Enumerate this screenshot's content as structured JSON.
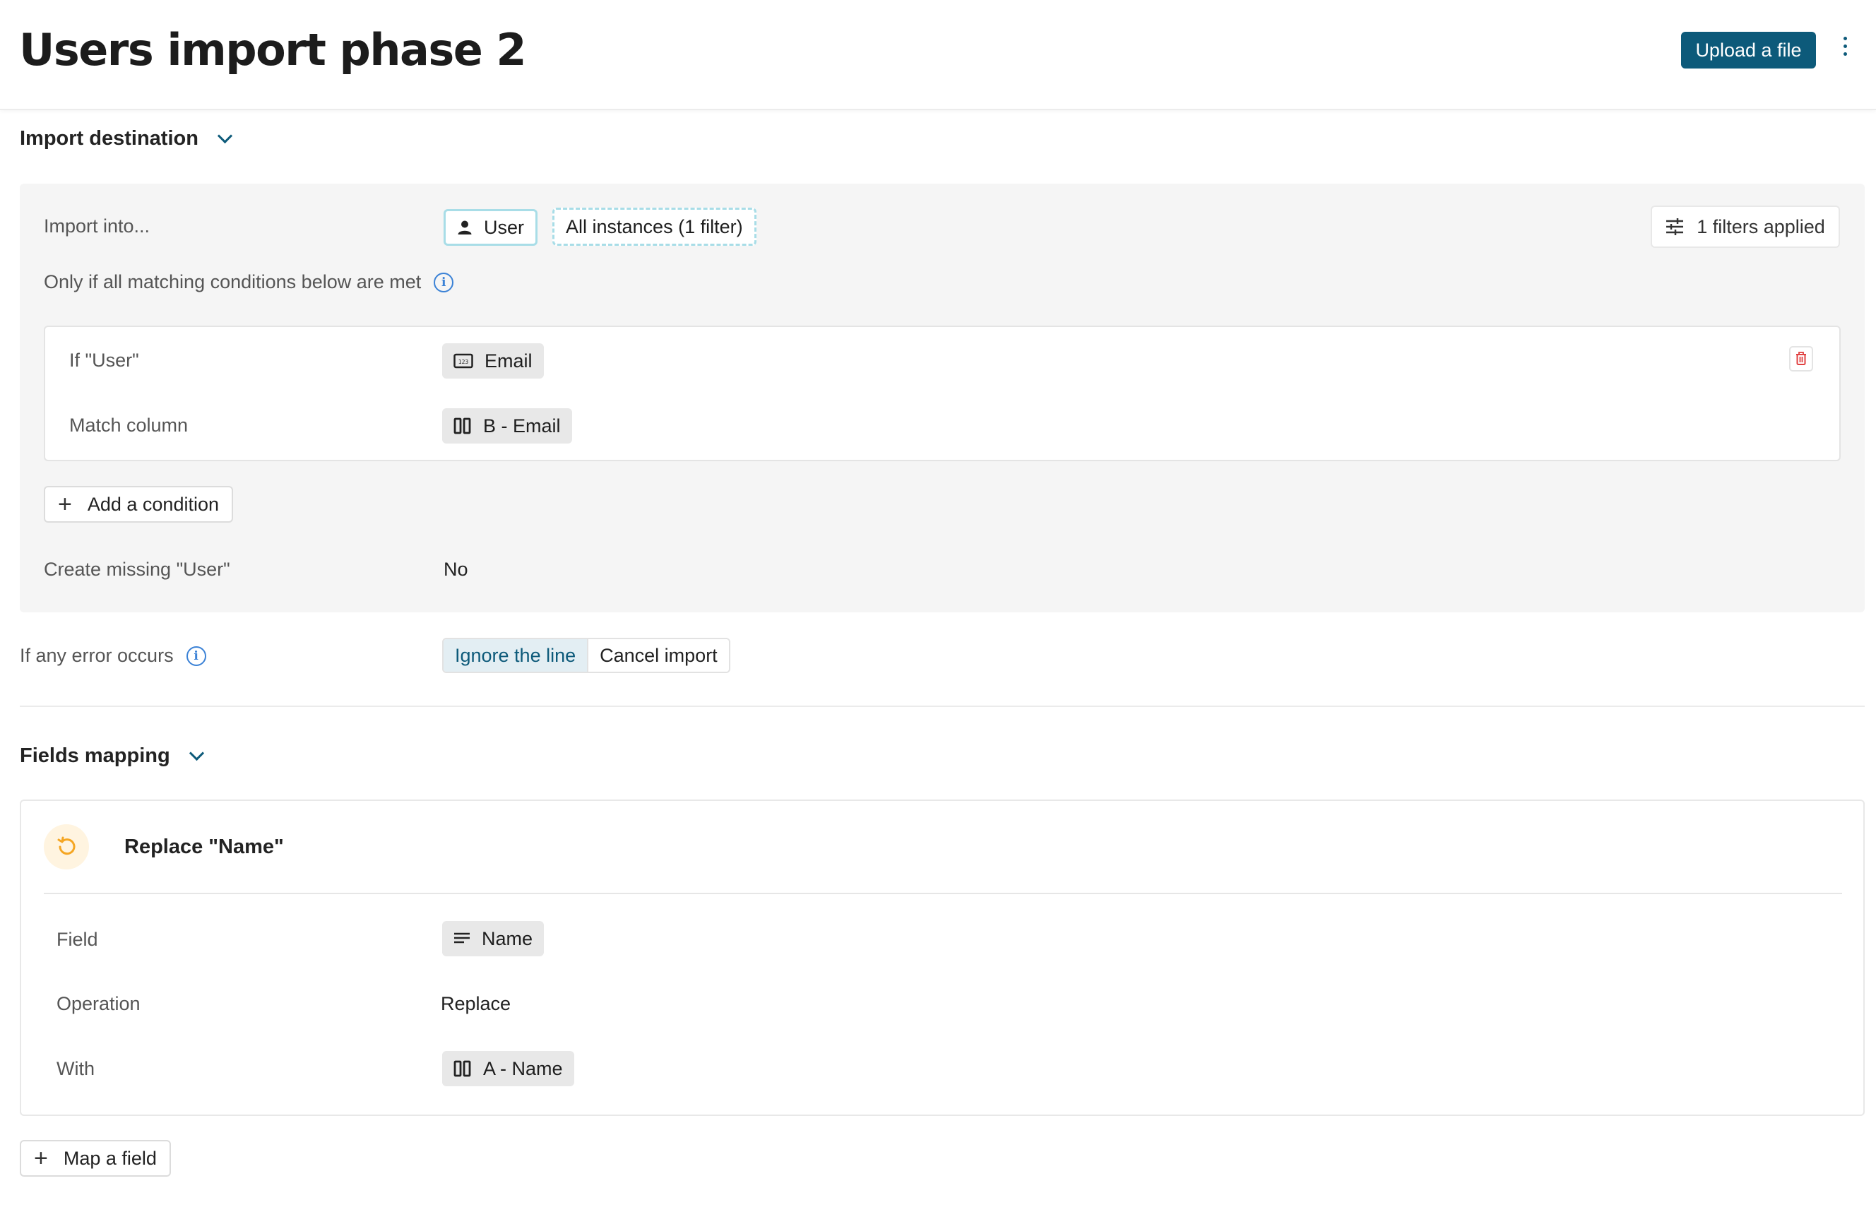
{
  "header": {
    "title": "Users import phase 2",
    "upload_label": "Upload a file"
  },
  "import_destination": {
    "section_label": "Import destination",
    "import_into_label": "Import into...",
    "entity_chip": "User",
    "instances_chip": "All instances (1 filter)",
    "filters_applied": "1 filters applied",
    "conditions_label": "Only if all matching conditions below are met",
    "condition": {
      "if_label": "If \"User\"",
      "if_value": "Email",
      "match_label": "Match column",
      "match_value": "B - Email"
    },
    "add_condition_label": "Add a condition",
    "create_missing_label": "Create missing \"User\"",
    "create_missing_value": "No"
  },
  "error_handling": {
    "label": "If any error occurs",
    "options": [
      "Ignore the line",
      "Cancel import"
    ],
    "selected": "Ignore the line"
  },
  "fields_mapping": {
    "section_label": "Fields mapping",
    "card_title": "Replace \"Name\"",
    "field_label": "Field",
    "field_value": "Name",
    "operation_label": "Operation",
    "operation_value": "Replace",
    "with_label": "With",
    "with_value": "A - Name",
    "map_field_label": "Map a field"
  },
  "colors": {
    "primary": "#0d5a7a",
    "info": "#3b82d6",
    "danger": "#e04040",
    "warning": "#f5a623"
  },
  "icons": [
    "kebab-menu-icon",
    "chevron-down-icon",
    "user-icon",
    "filter-settings-icon",
    "info-icon",
    "number-field-icon",
    "column-icon",
    "trash-icon",
    "plus-icon",
    "replace-icon",
    "text-lines-icon"
  ]
}
